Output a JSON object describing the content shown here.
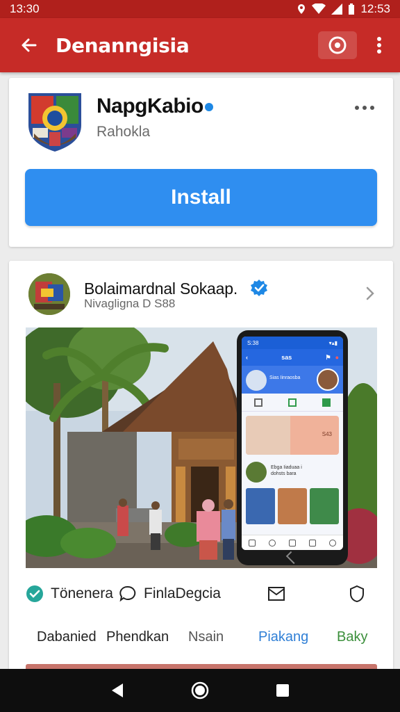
{
  "status_bar": {
    "time_left": "13:30",
    "time_right": "12:53"
  },
  "app_bar": {
    "title": "Denanngisia"
  },
  "app_card": {
    "name": "NapgKabio",
    "subtitle": "Rahokla",
    "install_label": "Install"
  },
  "post": {
    "title": "Bolaimardnal Sokaap.",
    "subtitle": "Nivagligna D S88",
    "phone": {
      "status_time": "S:38",
      "bar_title": "sas",
      "banner_text": "Sias Iinraosba",
      "card_text": "S43",
      "row_text_1": "Ebga Iiaduaa i",
      "row_text_2": "dohsts bara"
    },
    "actions": [
      {
        "label": "Tönenera",
        "icon": "check-circle-icon"
      },
      {
        "label": "FinlaDegcia",
        "icon": "comment-icon"
      },
      {
        "label": "",
        "icon": "mail-icon"
      },
      {
        "label": "",
        "icon": "shield-icon"
      }
    ],
    "tags": [
      {
        "label": "Dabanied",
        "color": "#222222"
      },
      {
        "label": "Phendkan",
        "color": "#222222"
      },
      {
        "label": "Nsain",
        "color": "#555555"
      },
      {
        "label": "Piakang",
        "color": "#2f7fd6"
      },
      {
        "label": "Baky",
        "color": "#3b8f3b"
      }
    ]
  },
  "colors": {
    "status_bar": "#b0201c",
    "app_bar": "#c62b27",
    "install_button": "#2f8ef0",
    "verified": "#1e88e5",
    "nav_bar": "#0e0e0e"
  }
}
